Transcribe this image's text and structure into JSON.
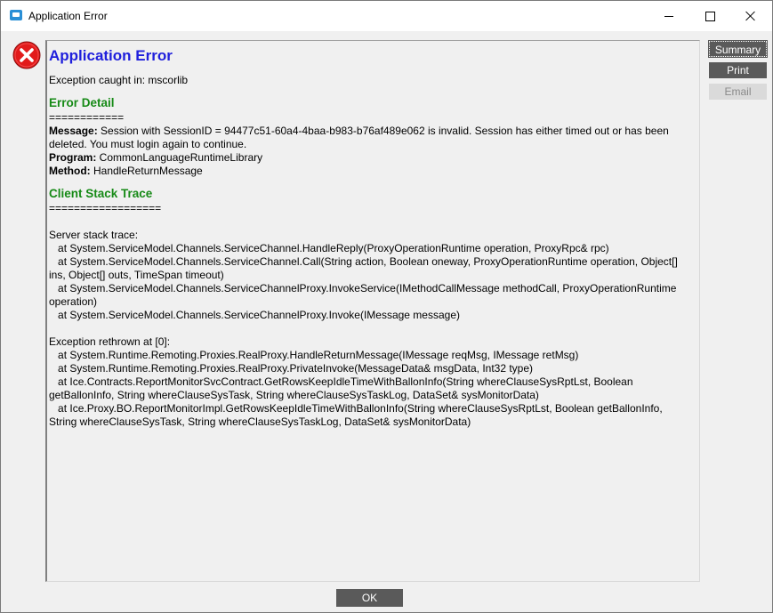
{
  "window": {
    "title": "Application Error"
  },
  "content": {
    "heading": "Application Error",
    "exception_caught": "Exception caught in: mscorlib",
    "error_detail_heading": "Error Detail",
    "error_detail_rule": "============",
    "message_label": "Message:",
    "message_value": " Session with SessionID = 94477c51-60a4-4baa-b983-b76af489e062 is invalid. Session has either timed out or has been deleted. You must login again to continue.",
    "program_label": "Program:",
    "program_value": " CommonLanguageRuntimeLibrary",
    "method_label": "Method:",
    "method_value": " HandleReturnMessage",
    "stack_heading": "Client Stack Trace",
    "stack_rule": "==================",
    "server_stack_title": "Server stack trace:",
    "server_stack_lines": [
      "   at System.ServiceModel.Channels.ServiceChannel.HandleReply(ProxyOperationRuntime operation, ProxyRpc& rpc)",
      "   at System.ServiceModel.Channels.ServiceChannel.Call(String action, Boolean oneway, ProxyOperationRuntime operation, Object[] ins, Object[] outs, TimeSpan timeout)",
      "   at System.ServiceModel.Channels.ServiceChannelProxy.InvokeService(IMethodCallMessage methodCall, ProxyOperationRuntime operation)",
      "   at System.ServiceModel.Channels.ServiceChannelProxy.Invoke(IMessage message)"
    ],
    "rethrown_title": "Exception rethrown at [0]:",
    "rethrown_lines": [
      "   at System.Runtime.Remoting.Proxies.RealProxy.HandleReturnMessage(IMessage reqMsg, IMessage retMsg)",
      "   at System.Runtime.Remoting.Proxies.RealProxy.PrivateInvoke(MessageData& msgData, Int32 type)",
      "   at Ice.Contracts.ReportMonitorSvcContract.GetRowsKeepIdleTimeWithBallonInfo(String whereClauseSysRptLst, Boolean getBallonInfo, String whereClauseSysTask, String whereClauseSysTaskLog, DataSet& sysMonitorData)",
      "   at Ice.Proxy.BO.ReportMonitorImpl.GetRowsKeepIdleTimeWithBallonInfo(String whereClauseSysRptLst, Boolean getBallonInfo, String whereClauseSysTask, String whereClauseSysTaskLog, DataSet& sysMonitorData)"
    ]
  },
  "buttons": {
    "summary": "Summary",
    "print": "Print",
    "email": "Email",
    "ok": "OK"
  },
  "icons": {
    "app": "app-window-icon",
    "error": "error-icon",
    "minimize": "minimize-icon",
    "maximize": "maximize-icon",
    "close": "close-icon"
  },
  "colors": {
    "heading_blue": "#1f1fdc",
    "section_green": "#168a16",
    "button_dark": "#5a5a5a",
    "error_red": "#e21b1b"
  }
}
